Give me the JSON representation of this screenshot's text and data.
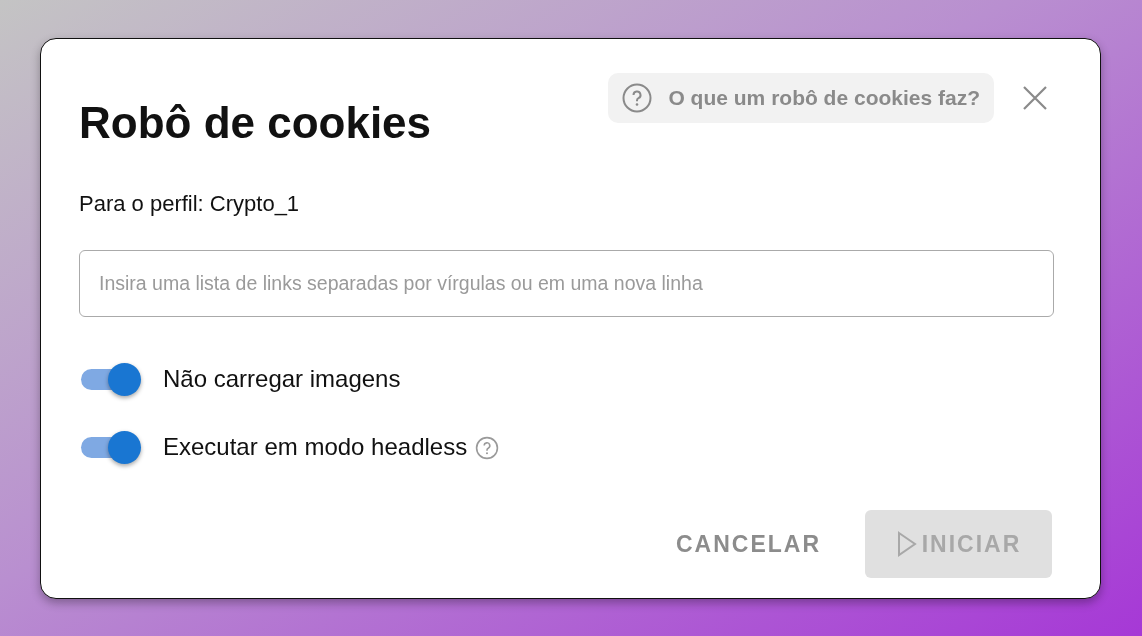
{
  "dialog": {
    "title": "Robô de cookies",
    "help_link": "O que um robô de cookies faz?",
    "profile": "Para o perfil: Crypto_1"
  },
  "links_field": {
    "placeholder": "Insira uma lista de links separadas por vírgulas ou em uma nova linha"
  },
  "options": [
    {
      "label": "Não carregar imagens",
      "on": true,
      "help": false
    },
    {
      "label": "Executar em modo headless",
      "on": true,
      "help": true
    }
  ],
  "buttons": [
    {
      "label": "CANCELAR",
      "kind": "text",
      "disabled": false
    },
    {
      "label": "INICIAR",
      "kind": "start",
      "disabled": true
    }
  ]
}
